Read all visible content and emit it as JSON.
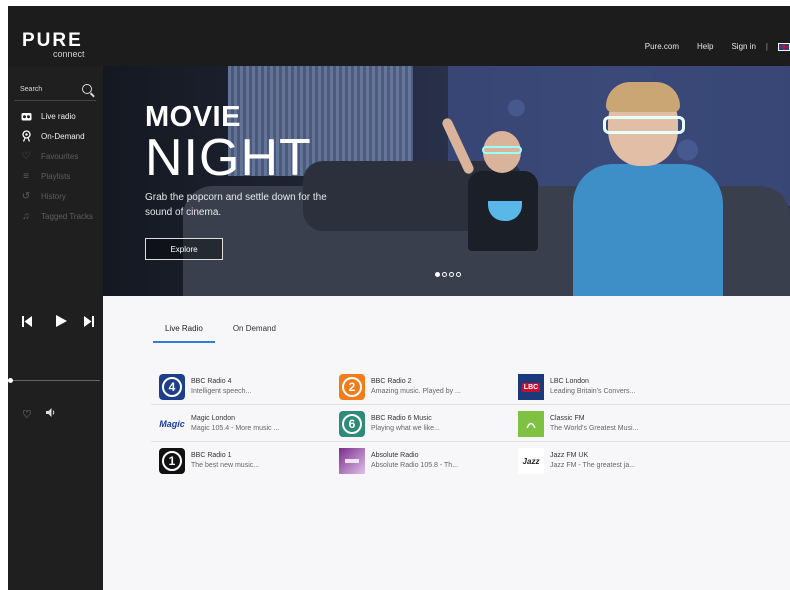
{
  "header": {
    "brand": "PURE",
    "brand_sub": "connect",
    "links": [
      "Pure.com",
      "Help",
      "Sign in"
    ],
    "divider": "|"
  },
  "sidebar": {
    "search_placeholder": "Search",
    "items": [
      {
        "label": "Live radio",
        "icon": "radio-icon",
        "enabled": true
      },
      {
        "label": "On-Demand",
        "icon": "podcast-icon",
        "enabled": true
      },
      {
        "label": "Favourites",
        "icon": "heart-outline-icon",
        "enabled": false
      },
      {
        "label": "Playlists",
        "icon": "playlist-icon",
        "enabled": false
      },
      {
        "label": "History",
        "icon": "history-icon",
        "enabled": false
      },
      {
        "label": "Tagged Tracks",
        "icon": "music-note-icon",
        "enabled": false
      }
    ],
    "progress": 0
  },
  "hero": {
    "title_line1": "MOVIE",
    "title_line2": "NIGHT",
    "description": "Grab the popcorn and settle down for the sound of cinema.",
    "cta": "Explore",
    "slides": 4,
    "active_slide": 0
  },
  "tabs": [
    {
      "label": "Live Radio",
      "active": true
    },
    {
      "label": "On Demand",
      "active": false
    }
  ],
  "stations": [
    [
      {
        "name": "BBC Radio 4",
        "desc": "Intelligent speech...",
        "logo": "4",
        "color": "#1d3f8a"
      },
      {
        "name": "BBC Radio 2",
        "desc": "Amazing music. Played by ...",
        "logo": "2",
        "color": "#f07d1a"
      },
      {
        "name": "LBC London",
        "desc": "Leading Britain's Convers...",
        "logo": "LBC",
        "color": "#1a3a7c"
      }
    ],
    [
      {
        "name": "Magic London",
        "desc": "Magic 105.4 - More music ...",
        "logo": "Magic",
        "color": "#1b3fa0"
      },
      {
        "name": "BBC Radio 6 Music",
        "desc": "Playing what we like...",
        "logo": "6",
        "color": "#2e8b7a"
      },
      {
        "name": "Classic FM",
        "desc": "The World's Greatest Musi...",
        "logo": "",
        "color": "#7fc241"
      }
    ],
    [
      {
        "name": "BBC Radio 1",
        "desc": "The best new music...",
        "logo": "1",
        "color": "#111111"
      },
      {
        "name": "Absolute Radio",
        "desc": "Absolute Radio 105.8 - Th...",
        "logo": "",
        "color": "#7a2d8c"
      },
      {
        "name": "Jazz FM UK",
        "desc": "Jazz FM - The greatest ja...",
        "logo": "Jazz",
        "color": "#ffffff"
      }
    ]
  ]
}
